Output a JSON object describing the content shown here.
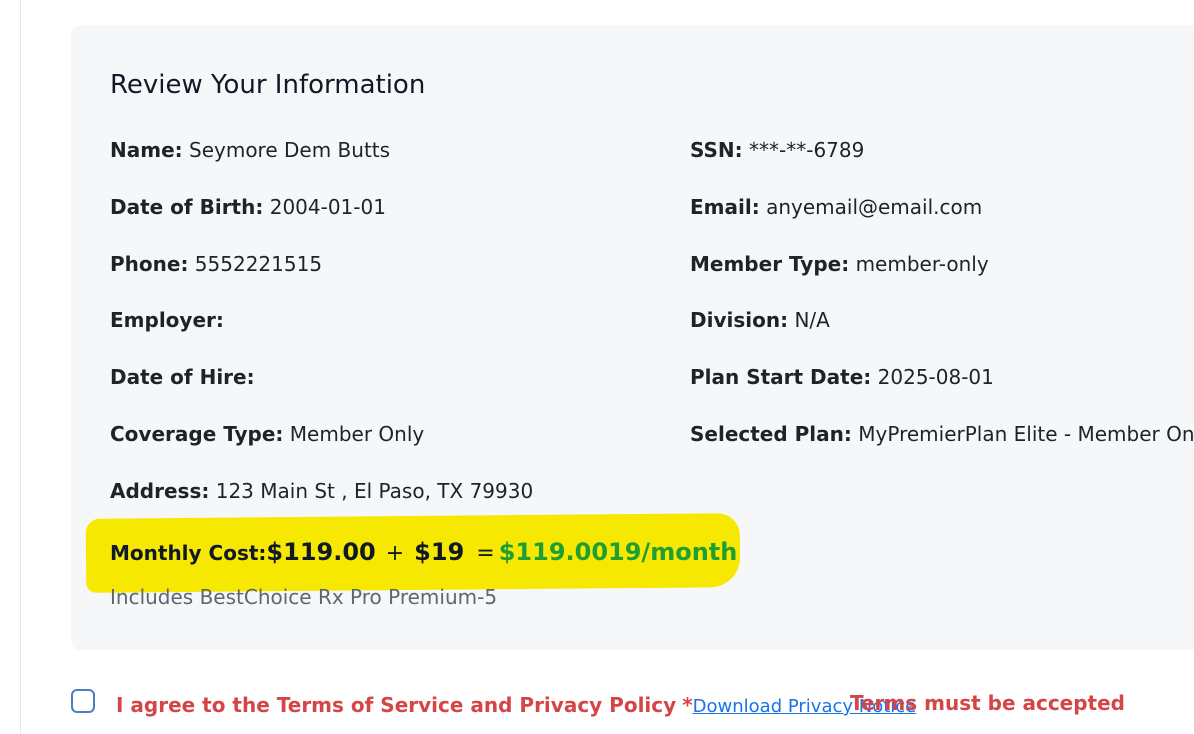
{
  "review": {
    "title": "Review Your Information",
    "fields_left": [
      {
        "label": "Name:",
        "value": "Seymore Dem Butts"
      },
      {
        "label": "Date of Birth:",
        "value": "2004-01-01"
      },
      {
        "label": "Phone:",
        "value": "5552221515"
      },
      {
        "label": "Employer:",
        "value": ""
      },
      {
        "label": "Date of Hire:",
        "value": ""
      },
      {
        "label": "Coverage Type:",
        "value": "Member Only"
      },
      {
        "label": "Address:",
        "value": "123 Main St , El Paso, TX 79930"
      }
    ],
    "fields_right": [
      {
        "label": "SSN:",
        "value": "***-**-6789"
      },
      {
        "label": "Email:",
        "value": "anyemail@email.com"
      },
      {
        "label": "Member Type:",
        "value": "member-only"
      },
      {
        "label": "Division:",
        "value": "N/A"
      },
      {
        "label": "Plan Start Date:",
        "value": "2025-08-01"
      },
      {
        "label": "Selected Plan:",
        "value": "MyPremierPlan Elite - Member Only"
      }
    ],
    "monthly_cost": {
      "label": "Monthly Cost:",
      "base": "$119.00",
      "plus": "+",
      "addon": "$19",
      "equals": "=",
      "total": "$119.0019/month"
    },
    "rx_note": "Includes BestChoice Rx Pro Premium-5"
  },
  "agreement": {
    "checked": false,
    "text": "I agree to the Terms of Service and Privacy Policy",
    "required_marker": "*",
    "link_text": "Download Privacy Notice",
    "error_text": "Terms must be accepted"
  },
  "colors": {
    "card_background": "#f6f7f9",
    "highlight": "#f6e800",
    "total_green": "#1f9e33",
    "error_red": "#d64545",
    "link_blue": "#1a73e8"
  }
}
